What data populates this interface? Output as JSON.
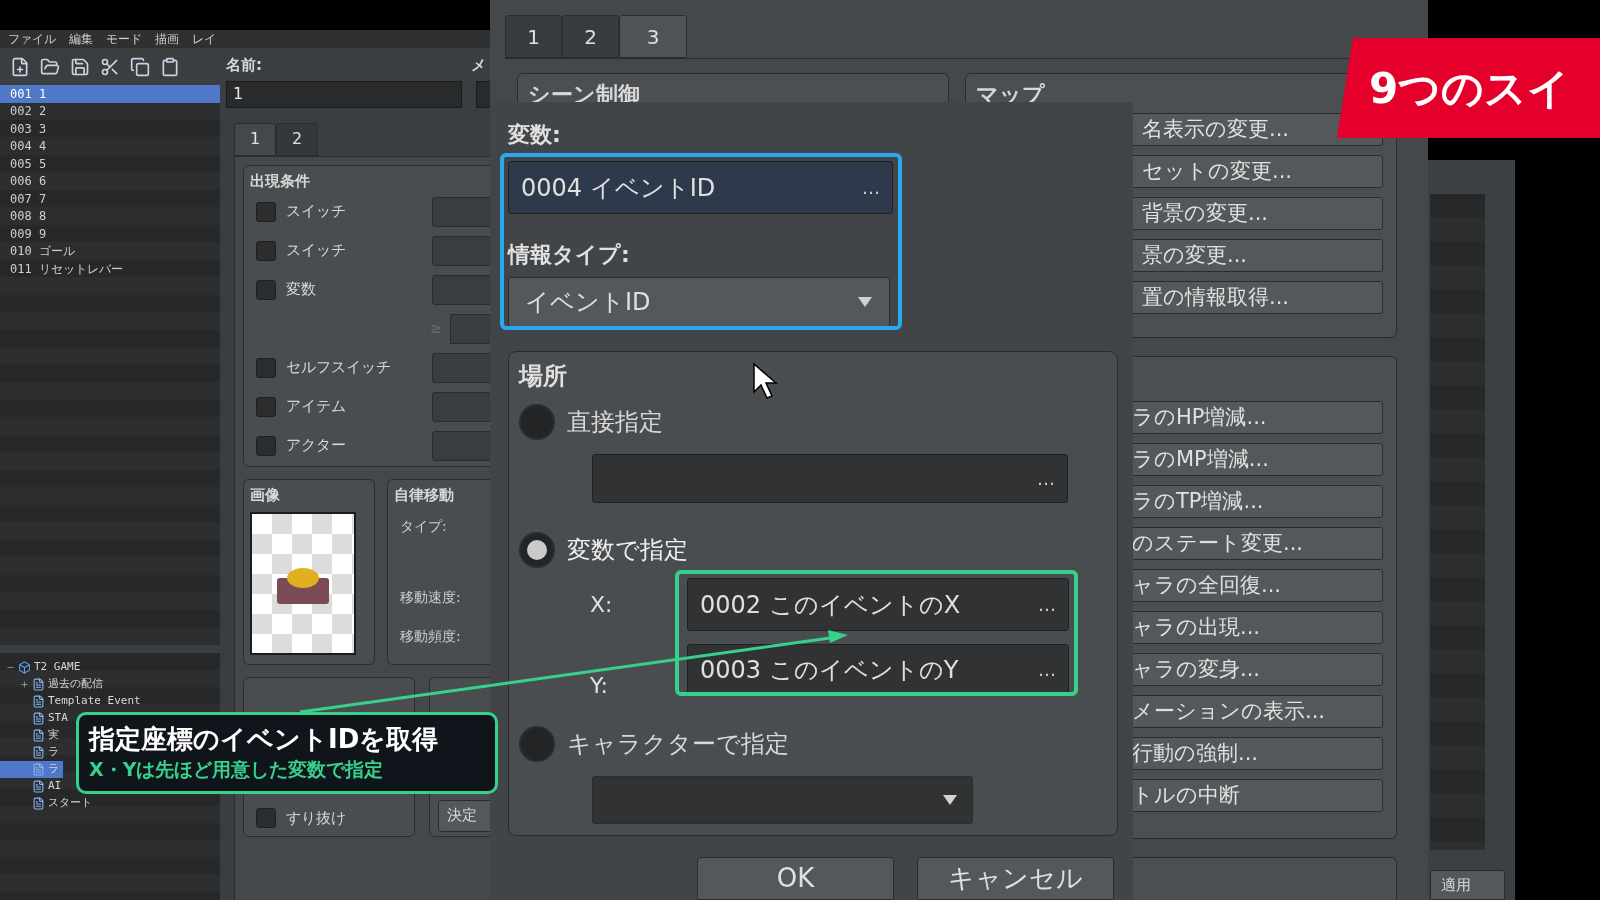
{
  "editor": {
    "menu": [
      "ファイル",
      "編集",
      "モード",
      "描画",
      "レイ"
    ],
    "maps": [
      {
        "label": "001 1",
        "selected": true
      },
      {
        "label": "002 2",
        "selected": false
      },
      {
        "label": "003 3",
        "selected": false
      },
      {
        "label": "004 4",
        "selected": false
      },
      {
        "label": "005 5",
        "selected": false
      },
      {
        "label": "006 6",
        "selected": false
      },
      {
        "label": "007 7",
        "selected": false
      },
      {
        "label": "008 8",
        "selected": false
      },
      {
        "label": "009 9",
        "selected": false
      },
      {
        "label": "010 ゴール",
        "selected": false
      },
      {
        "label": "011 リセットレバー",
        "selected": false
      }
    ],
    "tree": [
      {
        "label": "T2 GAME",
        "expanded": true,
        "selected": false,
        "children": [
          {
            "label": "過去の配信",
            "expanded": false,
            "selected": false
          },
          {
            "label": "Template Event",
            "selected": false
          },
          {
            "label": "STA",
            "selected": false
          },
          {
            "label": "実",
            "selected": false
          },
          {
            "label": "ラ",
            "selected": false
          },
          {
            "label": "ラ",
            "selected": true
          },
          {
            "label": "AI",
            "selected": false
          },
          {
            "label": "スタート",
            "selected": false
          }
        ]
      }
    ],
    "event": {
      "name_label": "名前:",
      "name_value": "1",
      "memo_label": "メ",
      "tabs": [
        {
          "label": "1",
          "selected": true
        },
        {
          "label": "2",
          "selected": false
        }
      ],
      "conditions": {
        "title": "出現条件",
        "compare": "≥",
        "items": [
          {
            "label": "スイッチ",
            "checked": false
          },
          {
            "label": "スイッチ",
            "checked": false
          },
          {
            "label": "変数",
            "checked": false
          },
          {
            "label": "セルフスイッチ",
            "checked": false
          },
          {
            "label": "アイテム",
            "checked": false
          },
          {
            "label": "アクター",
            "checked": false
          }
        ]
      },
      "image_title": "画像",
      "movement": {
        "title": "自律移動",
        "fields": [
          "タイプ:",
          "移動速度:",
          "移動頻度:"
        ]
      },
      "options": [
        {
          "label": "すり抜け",
          "checked": false
        }
      ],
      "decide_button": "決定"
    }
  },
  "command_dialog": {
    "tabs": [
      {
        "label": "1",
        "selected": false
      },
      {
        "label": "2",
        "selected": false
      },
      {
        "label": "3",
        "selected": true
      }
    ],
    "groups": [
      "シーン制御",
      "マップ"
    ],
    "map_buttons": [
      "名表示の変更...",
      "セットの変更...",
      "背景の変更...",
      "景の変更...",
      "置の情報取得..."
    ],
    "character_buttons": [
      "ラのHP増減...",
      "ラのMP増減...",
      "ラのTP増減...",
      "のステート変更...",
      "ャラの全回復...",
      "ャラの出現...",
      "ャラの変身...",
      "メーションの表示...",
      "行動の強制...",
      "トルの中断"
    ]
  },
  "side_panel": {
    "apply_button": "適用"
  },
  "popup": {
    "variable_label": "変数:",
    "variable_value": "0004 イベントID",
    "info_type_label": "情報タイプ:",
    "info_type_value": "イベントID",
    "location_title": "場所",
    "methods": [
      {
        "kind": "direct",
        "label": "直接指定",
        "selected": false
      },
      {
        "kind": "variable",
        "label": "変数で指定",
        "selected": true,
        "x_label": "X:",
        "x_value": "0002 このイベントのX",
        "y_label": "Y:",
        "y_value": "0003 このイベントのY"
      },
      {
        "kind": "character",
        "label": "キャラクターで指定",
        "selected": false
      }
    ],
    "ellipsis": "…",
    "ok_button": "OK",
    "cancel_button": "キャンセル"
  },
  "callout": {
    "title": "指定座標のイベントIDを取得",
    "subtitle": "X・Yは先ほど用意した変数で指定"
  },
  "banner": {
    "text": "9つのスイ"
  }
}
